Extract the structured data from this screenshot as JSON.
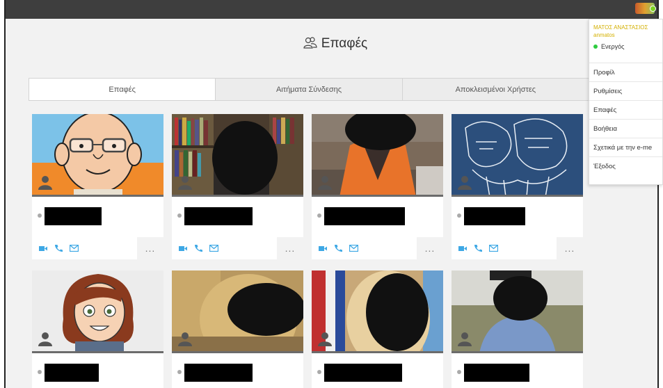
{
  "page": {
    "title": "Επαφές"
  },
  "tabs": [
    {
      "label": "Επαφές",
      "active": true
    },
    {
      "label": "Αιτήματα Σύνδεσης",
      "active": false
    },
    {
      "label": "Αποκλεισμένοι Χρήστες",
      "active": false
    }
  ],
  "user_menu": {
    "display_name": "ΜΑΤΟΣ ΑΝΑΣΤΑΣΙΟΣ",
    "username": "anmatos",
    "status": "Ενεργός",
    "items": [
      "Προφίλ",
      "Ρυθμίσεις",
      "Επαφές",
      "Βοήθεια",
      "Σχετικά με την e-me",
      "Έξοδος"
    ]
  },
  "contact_actions": {
    "video_icon": "video-camera-icon",
    "call_icon": "phone-icon",
    "message_icon": "envelope-icon",
    "more_label": "..."
  },
  "colors": {
    "accent": "#3ea8e5",
    "status_online": "#2ecc40",
    "menu_name": "#d4b000",
    "topbar": "#3e3e3e"
  }
}
